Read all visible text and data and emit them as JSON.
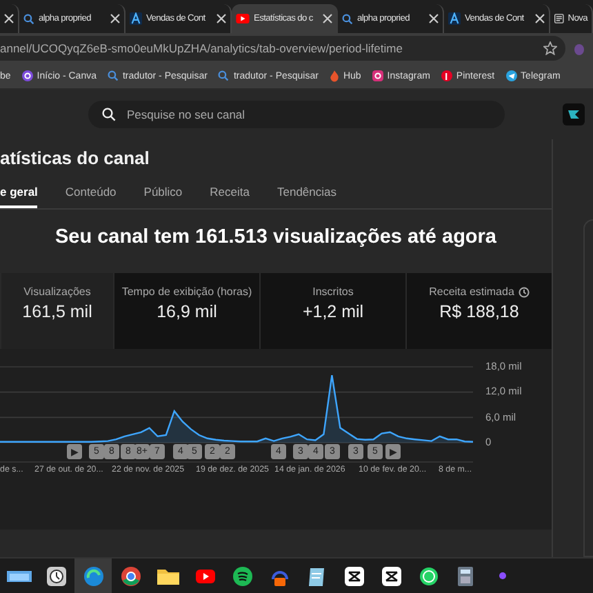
{
  "browser_tabs": [
    {
      "selected": false
    },
    {
      "title": "alpha propried",
      "selected": false
    },
    {
      "title": "Vendas de Cont",
      "selected": false
    },
    {
      "title": "Estatísticas do c",
      "selected": true
    },
    {
      "title": "alpha propried",
      "selected": false
    },
    {
      "title": "Vendas de Cont",
      "selected": false
    },
    {
      "title": "Nova",
      "selected": false
    }
  ],
  "address_bar": {
    "url": "annel/UCOQyqZ6eB-smo0euMkUpZHA/analytics/tab-overview/period-lifetime"
  },
  "bookmarks": [
    "be",
    "Início - Canva",
    "tradutor - Pesquisar",
    "tradutor - Pesquisar",
    "Hub",
    "Instagram",
    "Pinterest",
    "Telegram"
  ],
  "search": {
    "placeholder": "Pesquise no seu canal"
  },
  "page_title": "atísticas do canal",
  "tabs": [
    {
      "label": "e geral",
      "selected": true
    },
    {
      "label": "Conteúdo",
      "selected": false
    },
    {
      "label": "Público",
      "selected": false
    },
    {
      "label": "Receita",
      "selected": false
    },
    {
      "label": "Tendências",
      "selected": false
    }
  ],
  "headline": "Seu canal tem 161.513 visualizações até agora",
  "metrics": [
    {
      "label": "Visualizações",
      "value": "161,5 mil",
      "selected": true
    },
    {
      "label": "Tempo de exibição (horas)",
      "value": "16,9 mil",
      "selected": false
    },
    {
      "label": "Inscritos",
      "value": "+1,2 mil",
      "selected": false
    },
    {
      "label": "Receita estimada",
      "value": "R$ 188,18",
      "selected": false
    }
  ],
  "chart": {
    "markers": [
      "▶",
      "5",
      "8",
      "8",
      "8+",
      "7",
      "4",
      "5",
      "2",
      "2",
      "4",
      "3",
      "4",
      "3",
      "3",
      "5",
      "▶"
    ],
    "x_labels": [
      "de s...",
      "27 de out. de 20...",
      "22 de nov. de 2025",
      "19 de dez. de 2025",
      "14 de jan. de 2026",
      "10 de fev. de 20...",
      "8 de m..."
    ],
    "chart_data": {
      "type": "area",
      "ylim": [
        0,
        18
      ],
      "yticks": [
        {
          "value": 0,
          "label": "0"
        },
        {
          "value": 6,
          "label": "6,0 mil"
        },
        {
          "value": 12,
          "label": "12,0 mil"
        },
        {
          "value": 18,
          "label": "18,0 mil"
        }
      ],
      "series": [
        {
          "color": "#3ea6ff",
          "values": [
            0.2,
            0.2,
            0.2,
            0.2,
            0.2,
            0.2,
            0.2,
            0.2,
            0.2,
            0.2,
            0.2,
            0.2,
            0.3,
            0.4,
            0.8,
            1.5,
            2.0,
            2.5,
            3.5,
            1.5,
            1.8,
            7.5,
            5.0,
            3.2,
            1.8,
            1.0,
            0.7,
            0.5,
            0.4,
            0.3,
            0.3,
            0.3,
            1.0,
            0.4,
            1.0,
            1.4,
            2.0,
            0.8,
            0.6,
            2.0,
            16.0,
            3.5,
            2.2,
            0.9,
            0.7,
            0.8,
            2.2,
            2.5,
            1.5,
            1.0,
            0.8,
            0.6,
            0.4,
            1.5,
            0.8,
            0.8,
            0.3,
            0.2
          ]
        }
      ]
    }
  },
  "taskbar": [
    {
      "kind": "bars",
      "selected": false
    },
    {
      "kind": "clock",
      "selected": false
    },
    {
      "kind": "edge",
      "selected": true
    },
    {
      "kind": "chrome",
      "selected": false
    },
    {
      "kind": "folder",
      "selected": false
    },
    {
      "kind": "youtube",
      "selected": false
    },
    {
      "kind": "spotify",
      "selected": false
    },
    {
      "kind": "headphones",
      "selected": false
    },
    {
      "kind": "notepad",
      "selected": false
    },
    {
      "kind": "capcut",
      "selected": false
    },
    {
      "kind": "capcut",
      "selected": false
    },
    {
      "kind": "whatsapp",
      "selected": false
    },
    {
      "kind": "calculator",
      "selected": false
    },
    {
      "kind": "dot",
      "selected": false
    }
  ]
}
